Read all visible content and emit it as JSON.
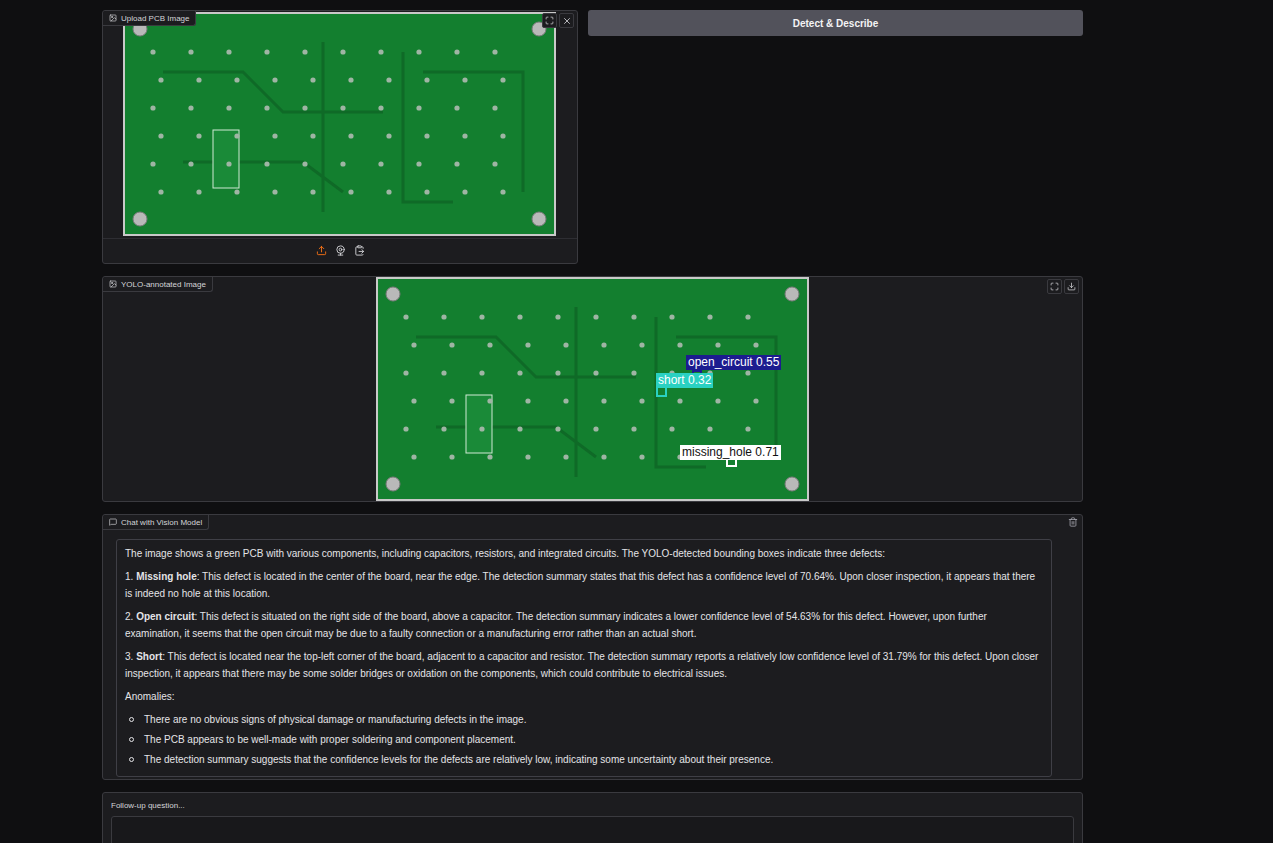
{
  "upload": {
    "label": "Upload PCB Image"
  },
  "detect_button": {
    "label": "Detect & Describe"
  },
  "annotated": {
    "label": "YOLO-annotated Image",
    "detections": [
      {
        "label": "open_circuit 0.55",
        "color": "#1c1c8f"
      },
      {
        "label": "short 0.32",
        "color": "#2ad1c2"
      },
      {
        "label": "missing_hole 0.71",
        "color": "#ffffff"
      }
    ]
  },
  "chat": {
    "label": "Chat with Vision Model",
    "message": {
      "intro": "The image shows a green PCB with various components, including capacitors, resistors, and integrated circuits. The YOLO-detected bounding boxes indicate three defects:",
      "defects": [
        {
          "number": "1.",
          "title": "Missing hole",
          "text": ": This defect is located in the center of the board, near the edge. The detection summary states that this defect has a confidence level of 70.64%. Upon closer inspection, it appears that there is indeed no hole at this location."
        },
        {
          "number": "2.",
          "title": "Open circuit",
          "text": ": This defect is situated on the right side of the board, above a capacitor. The detection summary indicates a lower confidence level of 54.63% for this defect. However, upon further examination, it seems that the open circuit may be due to a faulty connection or a manufacturing error rather than an actual short."
        },
        {
          "number": "3.",
          "title": "Short",
          "text": ": This defect is located near the top-left corner of the board, adjacent to a capacitor and resistor. The detection summary reports a relatively low confidence level of 31.79% for this defect. Upon closer inspection, it appears that there may be some solder bridges or oxidation on the components, which could contribute to electrical issues."
        }
      ],
      "anomalies_title": "Anomalies:",
      "anomalies": [
        "There are no obvious signs of physical damage or manufacturing defects in the image.",
        "The PCB appears to be well-made with proper soldering and component placement.",
        "The detection summary suggests that the confidence levels for the defects are relatively low, indicating some uncertainty about their presence."
      ]
    }
  },
  "followup": {
    "label": "Follow-up question...",
    "value": ""
  }
}
